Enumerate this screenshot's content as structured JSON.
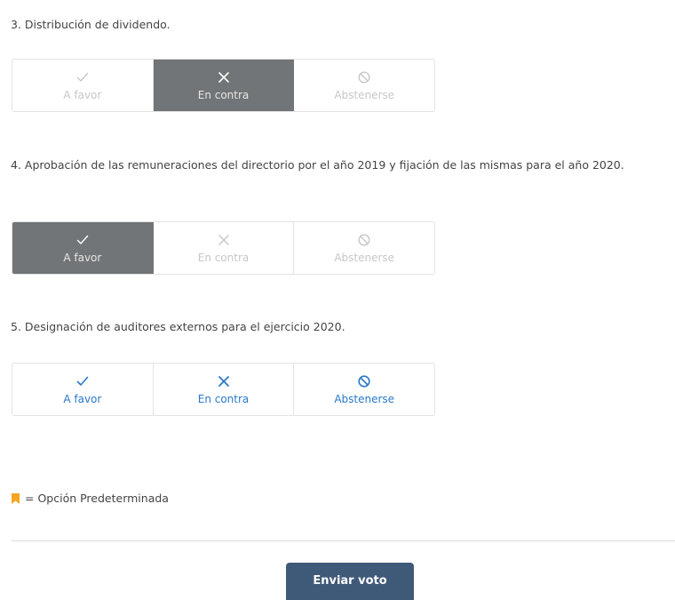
{
  "questions": [
    {
      "text": "3. Distribución de dividendo.",
      "options": [
        {
          "label": "A favor",
          "icon": "check-icon",
          "state": "disabled"
        },
        {
          "label": "En contra",
          "icon": "x-icon",
          "state": "selected"
        },
        {
          "label": "Abstenerse",
          "icon": "ban-icon",
          "state": "disabled"
        }
      ]
    },
    {
      "text": "4. Aprobación de las remuneraciones del directorio por el año 2019 y fijación de las mismas para el año 2020.",
      "options": [
        {
          "label": "A favor",
          "icon": "check-icon",
          "state": "selected"
        },
        {
          "label": "En contra",
          "icon": "x-icon",
          "state": "disabled"
        },
        {
          "label": "Abstenerse",
          "icon": "ban-icon",
          "state": "disabled"
        }
      ]
    },
    {
      "text": "5. Designación de auditores externos para el ejercicio 2020.",
      "options": [
        {
          "label": "A favor",
          "icon": "check-icon",
          "state": "active"
        },
        {
          "label": "En contra",
          "icon": "x-icon",
          "state": "active"
        },
        {
          "label": "Abstenerse",
          "icon": "ban-icon",
          "state": "active"
        }
      ]
    }
  ],
  "legend": {
    "text": "= Opción Predeterminada",
    "icon": "bookmark-icon",
    "color": "#f5a623"
  },
  "submit_label": "Enviar voto",
  "colors": {
    "selected_bg": "#727577",
    "active": "#2a78c8",
    "disabled": "#c7c7c7",
    "button_bg": "#3f5a78"
  }
}
